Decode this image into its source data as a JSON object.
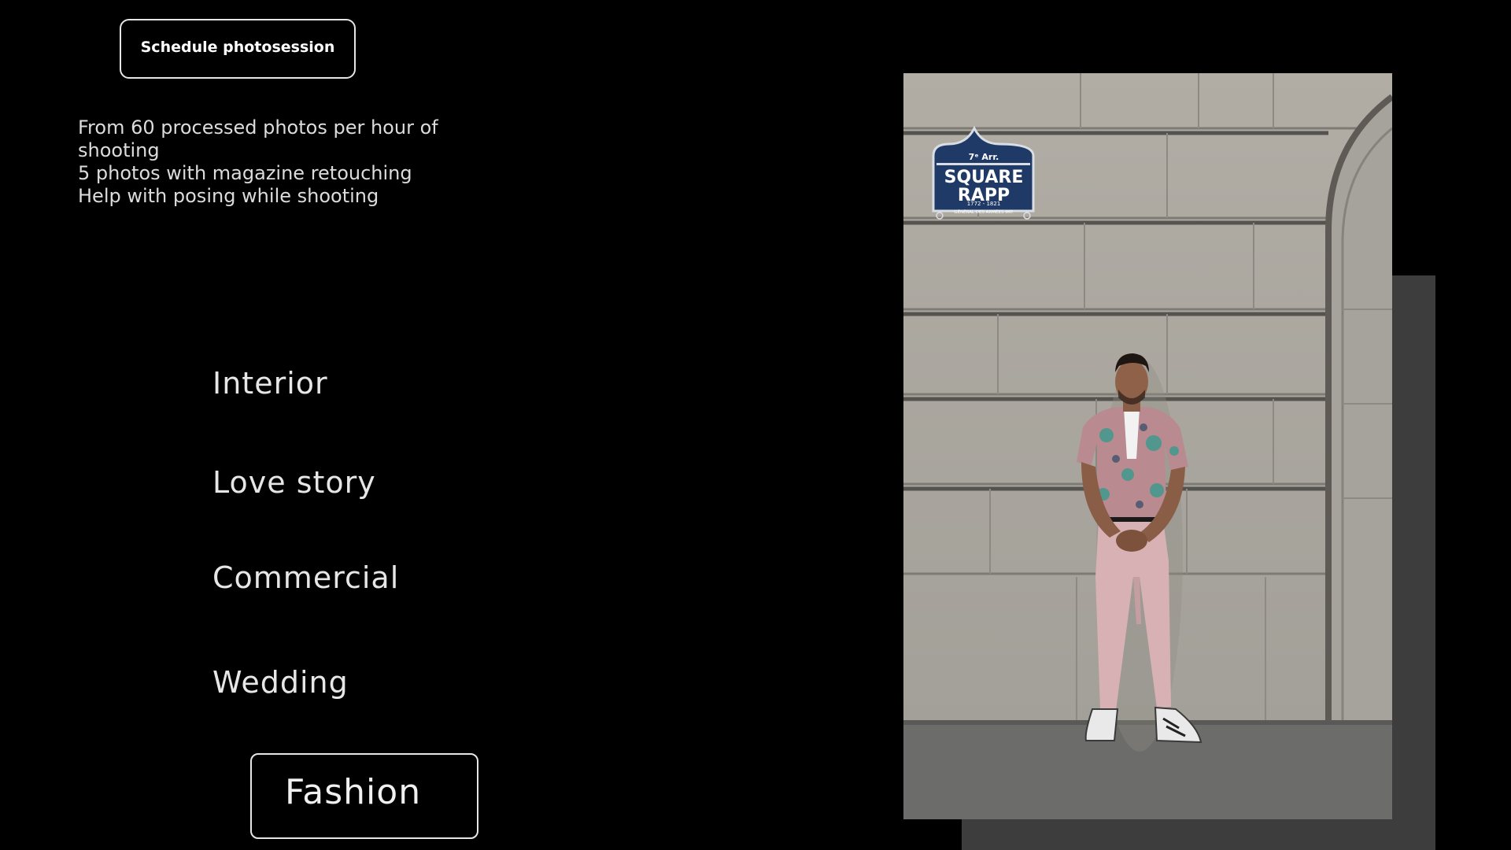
{
  "header": {
    "schedule_button_label": "Schedule photosession"
  },
  "features": [
    "From 60 processed photos per hour of shooting",
    "5 photos with magazine retouching",
    "Help with posing while shooting"
  ],
  "categories": {
    "interior": "Interior",
    "love_story": "Love story",
    "commercial": "Commercial",
    "wedding": "Wedding",
    "fashion": "Fashion",
    "selected": "Fashion"
  },
  "photo": {
    "sign": {
      "arrondissement": "7ᵉ Arr.",
      "line1": "SQUARE",
      "line2": "RAPP",
      "years": "1772 - 1821",
      "subtitle": "GÉNÉRAL DES ARMÉES IMP."
    }
  },
  "colors": {
    "background": "#000000",
    "text": "#e6e6e6",
    "shadow_panel": "#3d3d3d",
    "sign_blue": "#1f3a66"
  }
}
